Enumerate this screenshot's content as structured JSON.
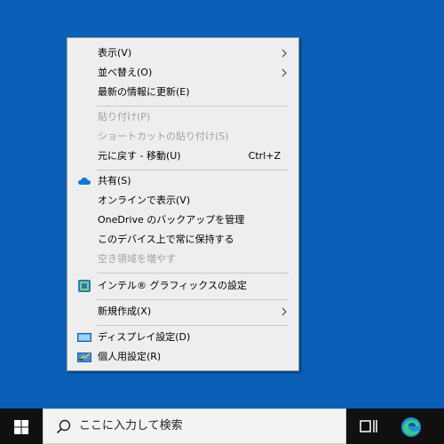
{
  "context_menu": {
    "items": [
      {
        "label": "表示(V)",
        "submenu": true
      },
      {
        "label": "並べ替え(O)",
        "submenu": true
      },
      {
        "label": "最新の情報に更新(E)"
      },
      {
        "label": "貼り付け(P)",
        "disabled": true
      },
      {
        "label": "ショートカットの貼り付け(S)",
        "disabled": true
      },
      {
        "label": "元に戻す - 移動(U)",
        "shortcut": "Ctrl+Z"
      },
      {
        "label": "共有(S)",
        "icon": "onedrive-cloud-icon"
      },
      {
        "label": "オンラインで表示(V)"
      },
      {
        "label": "OneDrive のバックアップを管理"
      },
      {
        "label": "このデバイス上で常に保持する"
      },
      {
        "label": "空き領域を増やす",
        "disabled": true
      },
      {
        "label": "インテル® グラフィックスの設定",
        "icon": "intel-graphics-icon"
      },
      {
        "label": "新規作成(X)",
        "submenu": true
      },
      {
        "label": "ディスプレイ設定(D)",
        "icon": "display-icon"
      },
      {
        "label": "個人用設定(R)",
        "icon": "personalize-icon",
        "highlighted": true
      }
    ]
  },
  "colors": {
    "desktop": "#0a60b6",
    "menu_bg": "#eeeeee",
    "highlight_border": "#e0141e",
    "taskbar": "#101010",
    "onedrive": "#0f78d4"
  },
  "taskbar": {
    "search_placeholder": "ここに入力して検索",
    "start_icon": "windows-logo-icon",
    "taskview_icon": "task-view-icon",
    "edge_icon": "edge-browser-icon"
  }
}
